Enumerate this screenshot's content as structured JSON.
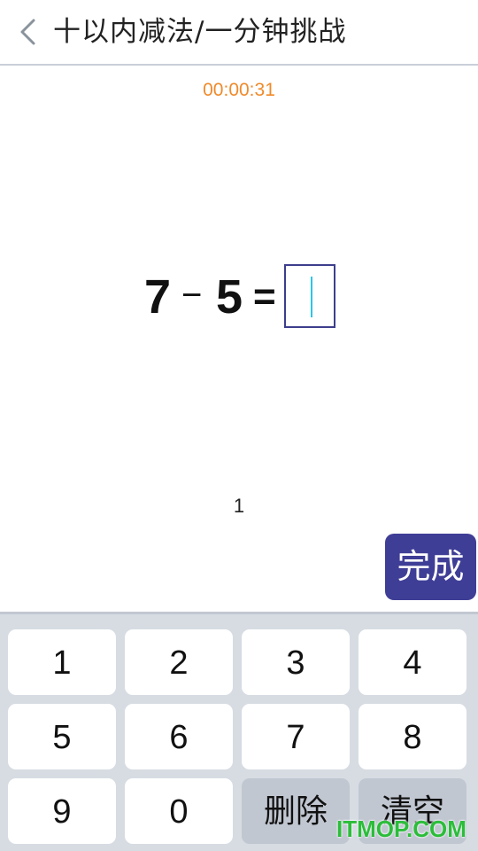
{
  "header": {
    "title": "十以内减法/一分钟挑战"
  },
  "timer": "00:00:31",
  "equation": {
    "operand1": "7",
    "operator": "−",
    "operand2": "5",
    "equals": "=",
    "answer": ""
  },
  "counter": "1",
  "done_label": "完成",
  "keypad": {
    "k1": "1",
    "k2": "2",
    "k3": "3",
    "k4": "4",
    "k5": "5",
    "k6": "6",
    "k7": "7",
    "k8": "8",
    "k9": "9",
    "k0": "0",
    "delete": "删除",
    "clear": "清空"
  },
  "watermark": "ITMOP.COM",
  "colors": {
    "accent": "#3f3e96",
    "timer": "#f08a2a",
    "keypad_bg": "#d7dce3",
    "caret": "#2ec4e6"
  }
}
